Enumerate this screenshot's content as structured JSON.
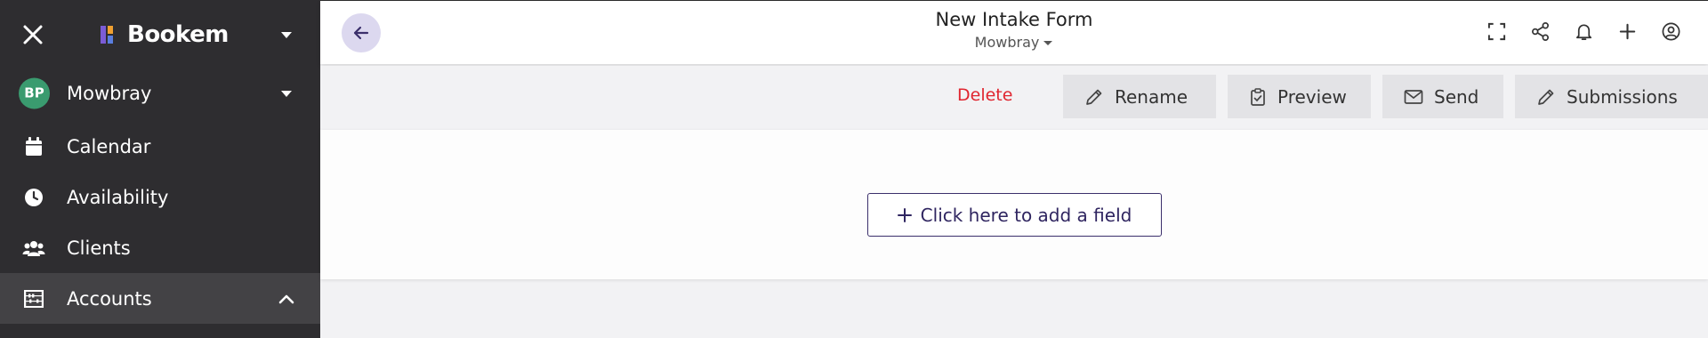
{
  "sidebar": {
    "brand": "Bookem",
    "items": [
      {
        "label": "Mowbray",
        "avatar_initials": "BP",
        "icon": "avatar"
      },
      {
        "label": "Calendar",
        "icon": "calendar-icon"
      },
      {
        "label": "Availability",
        "icon": "clock-icon"
      },
      {
        "label": "Clients",
        "icon": "users-icon"
      },
      {
        "label": "Accounts",
        "icon": "abacus-icon",
        "expanded": true
      }
    ]
  },
  "header": {
    "title": "New Intake Form",
    "subtitle": "Mowbray",
    "icons": [
      "fullscreen-icon",
      "share-icon",
      "bell-icon",
      "plus-icon",
      "account-icon"
    ]
  },
  "actions": {
    "delete": "Delete",
    "rename": "Rename",
    "preview": "Preview",
    "send": "Send",
    "submissions": "Submissions"
  },
  "content": {
    "add_field": "Click here to add a field"
  },
  "colors": {
    "sidebar_bg": "#2e2d30",
    "accent": "#3b2f6b",
    "delete": "#e0252f",
    "avatar": "#3a9b6f",
    "logo_purple": "#7b5cd6",
    "logo_orange": "#f0a030"
  }
}
